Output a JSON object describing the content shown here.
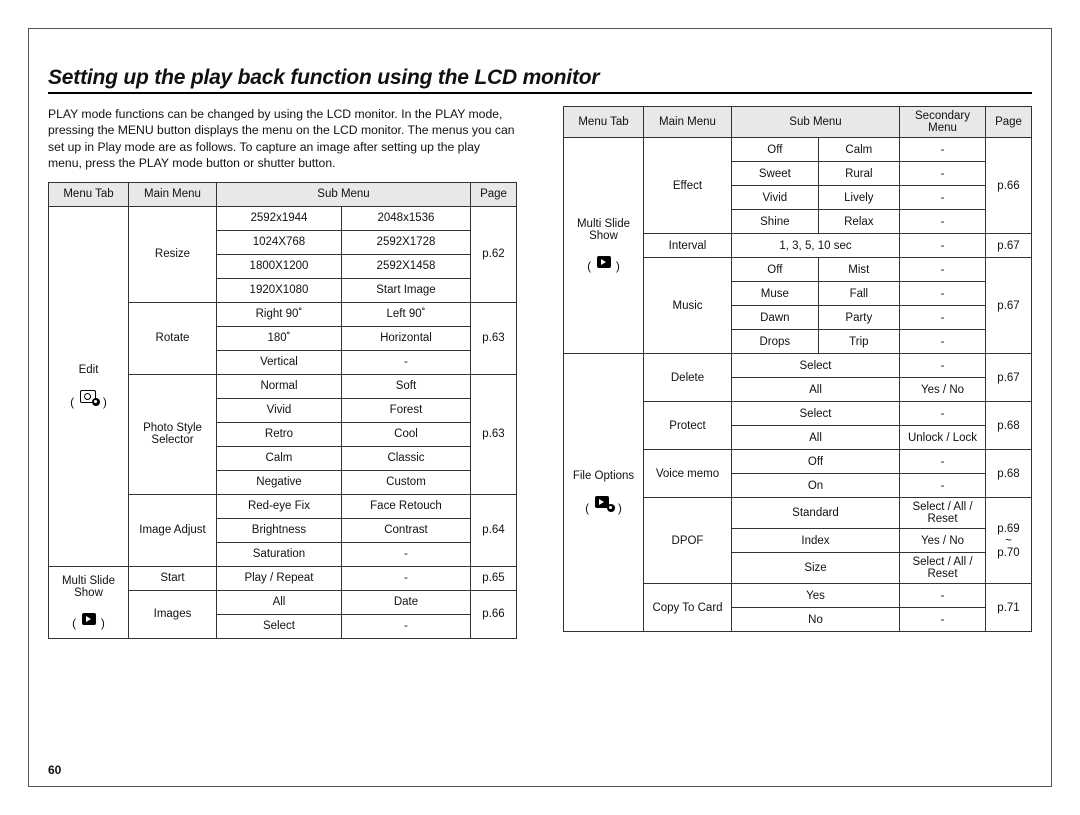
{
  "title": "Setting up the play back function using the LCD monitor",
  "intro": "PLAY mode functions can be changed by using the LCD monitor. In the PLAY mode, pressing the MENU button displays the menu on the LCD monitor. The menus you can set up in Play mode are as follows. To capture an image after setting up the play menu, press the PLAY mode button or shutter button.",
  "page_number": "60",
  "tableA": {
    "headers": [
      "Menu Tab",
      "Main Menu",
      "Sub Menu",
      "Page"
    ],
    "tabs": {
      "edit": "Edit",
      "slide": "Multi Slide Show"
    },
    "resize": {
      "label": "Resize",
      "rows": [
        [
          "2592x1944",
          "2048x1536"
        ],
        [
          "1024X768",
          "2592X1728"
        ],
        [
          "1800X1200",
          "2592X1458"
        ],
        [
          "1920X1080",
          "Start Image"
        ]
      ],
      "page": "p.62"
    },
    "rotate": {
      "label": "Rotate",
      "rows": [
        [
          "Right 90˚",
          "Left 90˚"
        ],
        [
          "180˚",
          "Horizontal"
        ],
        [
          "Vertical",
          "-"
        ]
      ],
      "page": "p.63"
    },
    "pss": {
      "label": "Photo Style Selector",
      "rows": [
        [
          "Normal",
          "Soft"
        ],
        [
          "Vivid",
          "Forest"
        ],
        [
          "Retro",
          "Cool"
        ],
        [
          "Calm",
          "Classic"
        ],
        [
          "Negative",
          "Custom"
        ]
      ],
      "page": "p.63"
    },
    "imgadj": {
      "label": "Image Adjust",
      "rows": [
        [
          "Red-eye Fix",
          "Face Retouch"
        ],
        [
          "Brightness",
          "Contrast"
        ],
        [
          "Saturation",
          "-"
        ]
      ],
      "page": "p.64"
    },
    "start": {
      "label": "Start",
      "sub": "Play / Repeat",
      "sec": "-",
      "page": "p.65"
    },
    "images": {
      "label": "Images",
      "rows": [
        [
          "All",
          "Date"
        ],
        [
          "Select",
          "-"
        ]
      ],
      "page": "p.66"
    }
  },
  "tableB": {
    "headers": [
      "Menu Tab",
      "Main Menu",
      "Sub Menu",
      "Secondary Menu",
      "Page"
    ],
    "tabs": {
      "slide": "Multi Slide Show",
      "file": "File Options"
    },
    "effect": {
      "label": "Effect",
      "rows": [
        [
          "Off",
          "Calm",
          "-"
        ],
        [
          "Sweet",
          "Rural",
          "-"
        ],
        [
          "Vivid",
          "Lively",
          "-"
        ],
        [
          "Shine",
          "Relax",
          "-"
        ]
      ],
      "page": "p.66"
    },
    "interval": {
      "label": "Interval",
      "sub": "1, 3, 5, 10 sec",
      "sec": "-",
      "page": "p.67"
    },
    "music": {
      "label": "Music",
      "rows": [
        [
          "Off",
          "Mist",
          "-"
        ],
        [
          "Muse",
          "Fall",
          "-"
        ],
        [
          "Dawn",
          "Party",
          "-"
        ],
        [
          "Drops",
          "Trip",
          "-"
        ]
      ],
      "page": "p.67"
    },
    "delete": {
      "label": "Delete",
      "rows": [
        [
          "Select",
          "-"
        ],
        [
          "All",
          "Yes / No"
        ]
      ],
      "page": "p.67"
    },
    "protect": {
      "label": "Protect",
      "rows": [
        [
          "Select",
          "-"
        ],
        [
          "All",
          "Unlock / Lock"
        ]
      ],
      "page": "p.68"
    },
    "voice": {
      "label": "Voice memo",
      "rows": [
        [
          "Off",
          "-"
        ],
        [
          "On",
          "-"
        ]
      ],
      "page": "p.68"
    },
    "dpof": {
      "label": "DPOF",
      "rows": [
        [
          "Standard",
          "Select / All / Reset"
        ],
        [
          "Index",
          "Yes / No"
        ],
        [
          "Size",
          "Select / All / Reset"
        ]
      ],
      "page": "p.69\n~\np.70"
    },
    "copy": {
      "label": "Copy To Card",
      "rows": [
        [
          "Yes",
          "-"
        ],
        [
          "No",
          "-"
        ]
      ],
      "page": "p.71"
    }
  }
}
